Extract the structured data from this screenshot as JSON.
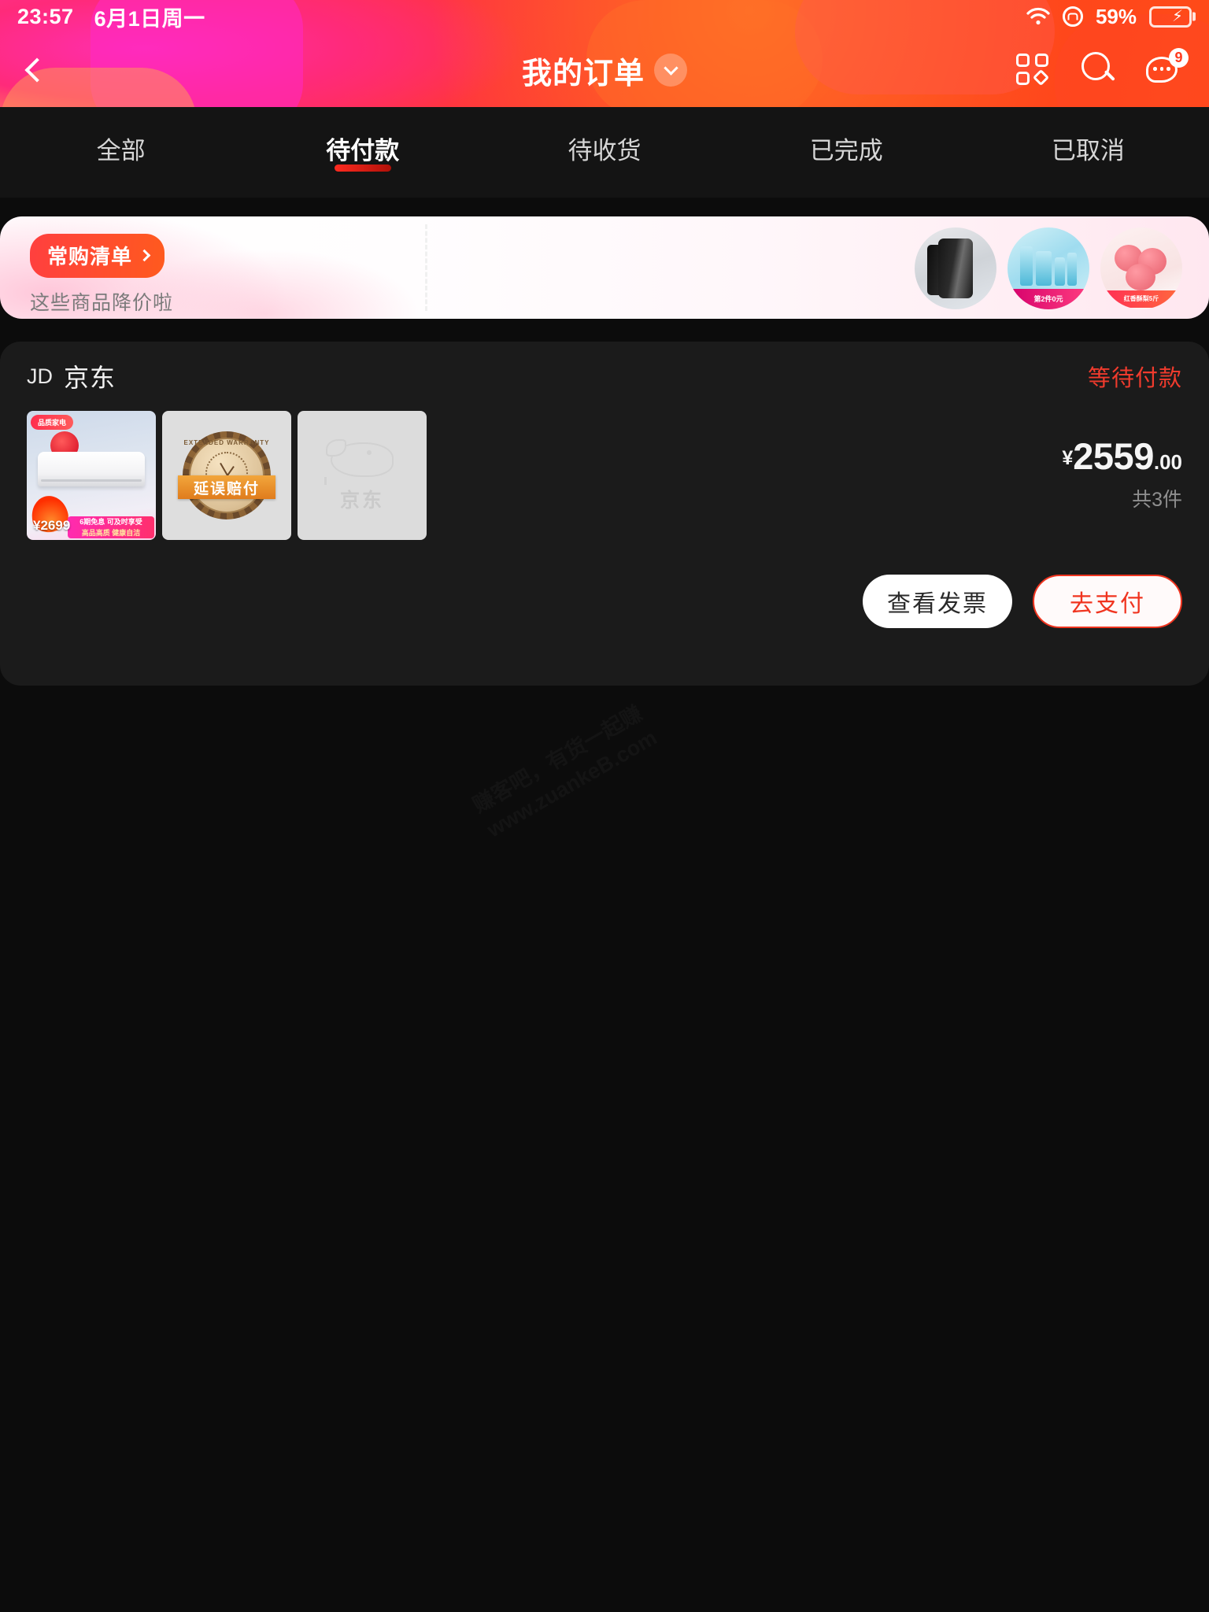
{
  "status_bar": {
    "time": "23:57",
    "date": "6月1日周一",
    "battery_percent": "59%",
    "wifi_icon": "wifi-icon",
    "rotation_lock_icon": "rotation-lock-icon",
    "battery_icon": "battery-charging-icon"
  },
  "header": {
    "back_icon": "chevron-left-icon",
    "title": "我的订单",
    "title_chevron_icon": "chevron-down-icon",
    "actions": [
      {
        "name": "grid-icon",
        "label": ""
      },
      {
        "name": "search-icon",
        "label": ""
      },
      {
        "name": "message-icon",
        "badge": "9"
      }
    ],
    "accent_start": "#ff2d9b",
    "accent_end": "#ff4b18"
  },
  "tabs": [
    {
      "label": "全部",
      "active": false
    },
    {
      "label": "待付款",
      "active": true
    },
    {
      "label": "待收货",
      "active": false
    },
    {
      "label": "已完成",
      "active": false
    },
    {
      "label": "已取消",
      "active": false
    }
  ],
  "banner": {
    "chip_label": "常购清单",
    "chip_chevron_icon": "chevron-right-icon",
    "subtitle": "这些商品降价啦",
    "thumbs": [
      {
        "name": "banner-thumb-cleanser",
        "caption": ""
      },
      {
        "name": "banner-thumb-skincare-set",
        "caption": "第2件0元"
      },
      {
        "name": "banner-thumb-peaches",
        "caption": "红香酥梨5斤"
      }
    ]
  },
  "order": {
    "shop_mark": "JD",
    "shop_name": "京东",
    "status": "等待付款",
    "status_color": "#f03b2d",
    "thumbs": [
      {
        "name": "order-thumb-air-conditioner",
        "price_tag": "¥2699",
        "top_tag": "品质家电",
        "bottom_line1": "6期免息 可及时享受",
        "bottom_line2": "高品高质 健康自洁"
      },
      {
        "name": "order-thumb-warranty-seal",
        "ribbon": "延误赔付",
        "seal_top": "EXTENDED WARRANTY"
      },
      {
        "name": "order-thumb-jd-placeholder",
        "logo_text": "京东"
      }
    ],
    "currency_symbol": "¥",
    "price_integer": "2559",
    "price_decimal": ".00",
    "quantity": "共3件",
    "buttons": [
      {
        "label": "查看发票",
        "style": "secondary"
      },
      {
        "label": "去支付",
        "style": "primary"
      }
    ]
  },
  "watermark": {
    "line1": "赚客吧，有货一起赚",
    "line2": "www.zuankeB.com"
  }
}
